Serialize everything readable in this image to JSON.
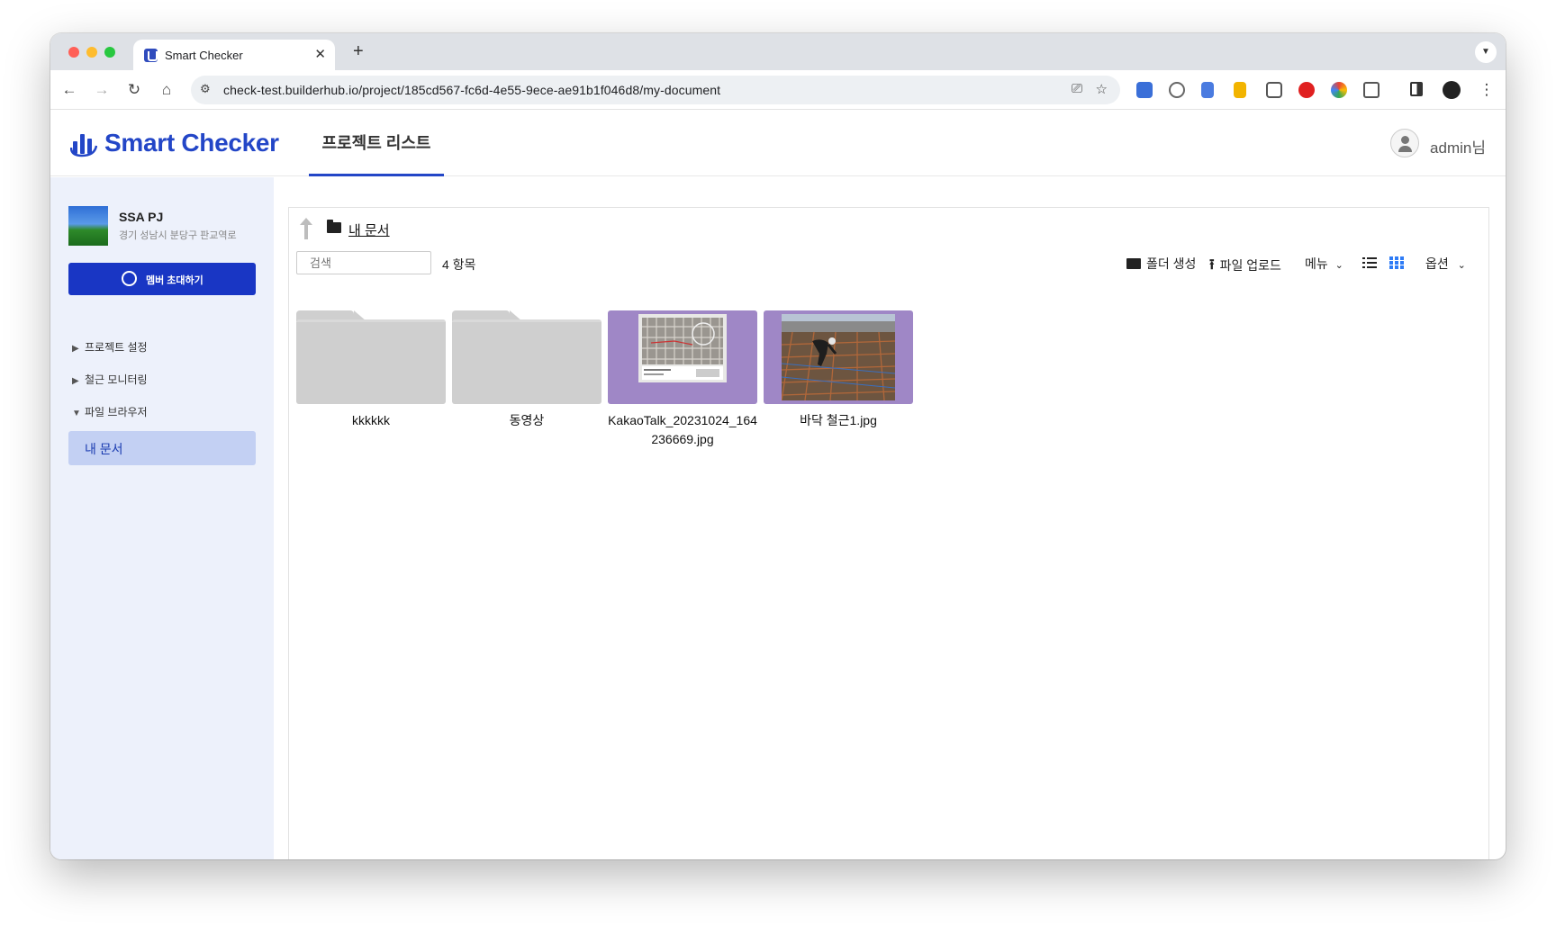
{
  "browser": {
    "tab_title": "Smart Checker",
    "tab_close": "✕",
    "new_tab": "+",
    "url": "check-test.builderhub.io/project/185cd567-fc6d-4e55-9ece-ae91b1f046d8/my-document",
    "nav": {
      "back": "←",
      "forward": "→",
      "reload": "↻",
      "home": "⌂"
    },
    "extension_colors": [
      "#3a6fd8",
      "#666666",
      "#4a7be0",
      "#f2b400",
      "#555555",
      "#e02020",
      "#34a853",
      "#555555"
    ]
  },
  "app": {
    "logo_text": "Smart Checker",
    "brand_color": "#2346c7",
    "nav_tab": "프로젝트 리스트",
    "user_name": "admin님"
  },
  "sidebar": {
    "project_name": "SSA PJ",
    "project_address": "경기 성남시 분당구 판교역로",
    "invite_button": "멤버 초대하기",
    "menu": [
      {
        "arrow": "▶",
        "label": "프로젝트 설정"
      },
      {
        "arrow": "▶",
        "label": "철근 모니터링"
      },
      {
        "arrow": "▼",
        "label": "파일 브라우저"
      }
    ],
    "active_sub_item": "내 문서"
  },
  "browser_panel": {
    "breadcrumb": "내 문서",
    "search_placeholder": "검색",
    "item_count": "4 항목",
    "create_folder": "폴더 생성",
    "upload_file": "파일 업로드",
    "menu": "메뉴",
    "options": "옵션",
    "selected_view": "grid",
    "items": [
      {
        "type": "folder",
        "name": "kkkkkk"
      },
      {
        "type": "folder",
        "name": "동영상"
      },
      {
        "type": "image",
        "name": "KakaoTalk_20231024_164236669.jpg"
      },
      {
        "type": "image",
        "name": "바닥 철근1.jpg"
      }
    ]
  }
}
